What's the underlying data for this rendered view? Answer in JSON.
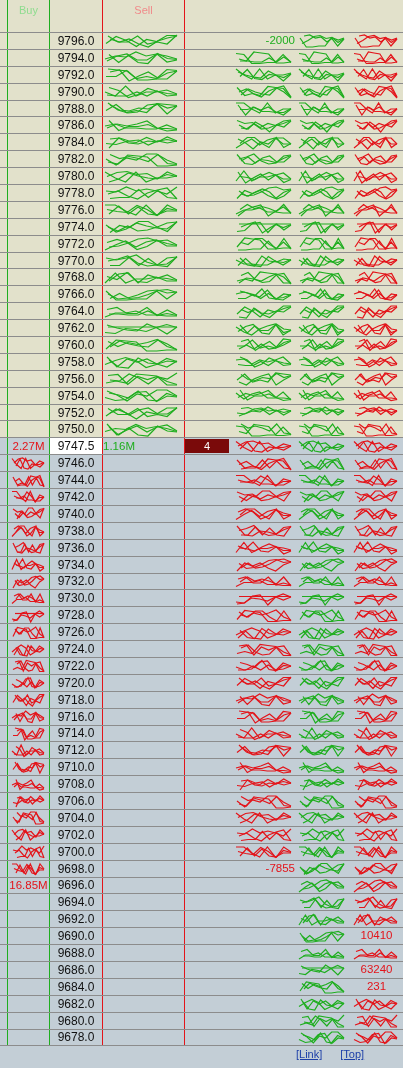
{
  "header": {
    "buy": "Buy",
    "sell": "Sell"
  },
  "rows": [
    {
      "price": "9796.0",
      "ask": true,
      "highlighted": false,
      "column_4": "-2000",
      "overlap_buy": false,
      "overlap_sell": true,
      "overlap_4": false,
      "overlap_5": true,
      "overlap_6": true
    },
    {
      "price": "9794.0",
      "ask": true,
      "highlighted": false,
      "overlap_buy": false,
      "overlap_sell": true,
      "overlap_4": true,
      "overlap_5": true,
      "overlap_6": true
    },
    {
      "price": "9792.0",
      "ask": true,
      "highlighted": false,
      "overlap_buy": false,
      "overlap_sell": true,
      "overlap_4": true,
      "overlap_5": true,
      "overlap_6": true
    },
    {
      "price": "9790.0",
      "ask": true,
      "highlighted": false,
      "overlap_buy": false,
      "overlap_sell": true,
      "overlap_4": true,
      "overlap_5": true,
      "overlap_6": true
    },
    {
      "price": "9788.0",
      "ask": true,
      "highlighted": false,
      "overlap_buy": false,
      "overlap_sell": true,
      "overlap_4": true,
      "overlap_5": true,
      "overlap_6": true
    },
    {
      "price": "9786.0",
      "ask": true,
      "highlighted": false,
      "overlap_buy": false,
      "overlap_sell": true,
      "overlap_4": true,
      "overlap_5": true,
      "overlap_6": true
    },
    {
      "price": "9784.0",
      "ask": true,
      "highlighted": false,
      "overlap_buy": false,
      "overlap_sell": true,
      "overlap_4": true,
      "overlap_5": true,
      "overlap_6": true
    },
    {
      "price": "9782.0",
      "ask": true,
      "highlighted": false,
      "overlap_buy": false,
      "overlap_sell": true,
      "overlap_4": true,
      "overlap_5": true,
      "overlap_6": true
    },
    {
      "price": "9780.0",
      "ask": true,
      "highlighted": false,
      "overlap_buy": false,
      "overlap_sell": true,
      "overlap_4": true,
      "overlap_5": true,
      "overlap_6": true
    },
    {
      "price": "9778.0",
      "ask": true,
      "highlighted": false,
      "overlap_buy": false,
      "overlap_sell": true,
      "overlap_4": true,
      "overlap_5": true,
      "overlap_6": true
    },
    {
      "price": "9776.0",
      "ask": true,
      "highlighted": false,
      "overlap_buy": false,
      "overlap_sell": true,
      "overlap_4": true,
      "overlap_5": true,
      "overlap_6": true
    },
    {
      "price": "9774.0",
      "ask": true,
      "highlighted": false,
      "overlap_buy": false,
      "overlap_sell": true,
      "overlap_4": true,
      "overlap_5": true,
      "overlap_6": true
    },
    {
      "price": "9772.0",
      "ask": true,
      "highlighted": false,
      "overlap_buy": false,
      "overlap_sell": true,
      "overlap_4": true,
      "overlap_5": true,
      "overlap_6": true
    },
    {
      "price": "9770.0",
      "ask": true,
      "highlighted": false,
      "overlap_buy": false,
      "overlap_sell": true,
      "overlap_4": true,
      "overlap_5": true,
      "overlap_6": true
    },
    {
      "price": "9768.0",
      "ask": true,
      "highlighted": false,
      "overlap_buy": false,
      "overlap_sell": true,
      "overlap_4": true,
      "overlap_5": true,
      "overlap_6": true
    },
    {
      "price": "9766.0",
      "ask": true,
      "highlighted": false,
      "overlap_buy": false,
      "overlap_sell": true,
      "overlap_4": true,
      "overlap_5": true,
      "overlap_6": true
    },
    {
      "price": "9764.0",
      "ask": true,
      "highlighted": false,
      "overlap_buy": false,
      "overlap_sell": true,
      "overlap_4": true,
      "overlap_5": true,
      "overlap_6": true
    },
    {
      "price": "9762.0",
      "ask": true,
      "highlighted": false,
      "overlap_buy": false,
      "overlap_sell": true,
      "overlap_4": true,
      "overlap_5": true,
      "overlap_6": true
    },
    {
      "price": "9760.0",
      "ask": true,
      "highlighted": false,
      "overlap_buy": false,
      "overlap_sell": true,
      "overlap_4": true,
      "overlap_5": true,
      "overlap_6": true
    },
    {
      "price": "9758.0",
      "ask": true,
      "highlighted": false,
      "overlap_buy": false,
      "overlap_sell": true,
      "overlap_4": true,
      "overlap_5": true,
      "overlap_6": true
    },
    {
      "price": "9756.0",
      "ask": true,
      "highlighted": false,
      "overlap_buy": false,
      "overlap_sell": true,
      "overlap_4": true,
      "overlap_5": true,
      "overlap_6": true
    },
    {
      "price": "9754.0",
      "ask": true,
      "highlighted": false,
      "overlap_buy": false,
      "overlap_sell": true,
      "overlap_4": true,
      "overlap_5": true,
      "overlap_6": true
    },
    {
      "price": "9752.0",
      "ask": true,
      "highlighted": false,
      "overlap_buy": false,
      "overlap_sell": true,
      "overlap_4": true,
      "overlap_5": true,
      "overlap_6": true
    },
    {
      "price": "9750.0",
      "ask": true,
      "highlighted": false,
      "overlap_buy": false,
      "overlap_sell": true,
      "overlap_4": true,
      "overlap_5": true,
      "overlap_6": true
    },
    {
      "price": "9747.5",
      "ask": false,
      "highlighted": true,
      "buy": "2.27M",
      "sell": "1.16M",
      "order_count": "4",
      "overlap_buy": false,
      "overlap_sell": false,
      "overlap_4": true,
      "overlap_5": true,
      "overlap_6": true
    },
    {
      "price": "9746.0",
      "ask": false,
      "highlighted": false,
      "overlap_buy": true,
      "overlap_sell": false,
      "overlap_4": true,
      "overlap_5": true,
      "overlap_6": true
    },
    {
      "price": "9744.0",
      "ask": false,
      "highlighted": false,
      "overlap_buy": true,
      "overlap_sell": false,
      "overlap_4": true,
      "overlap_5": true,
      "overlap_6": true
    },
    {
      "price": "9742.0",
      "ask": false,
      "highlighted": false,
      "overlap_buy": true,
      "overlap_sell": false,
      "overlap_4": true,
      "overlap_5": true,
      "overlap_6": true
    },
    {
      "price": "9740.0",
      "ask": false,
      "highlighted": false,
      "overlap_buy": true,
      "overlap_sell": false,
      "overlap_4": true,
      "overlap_5": true,
      "overlap_6": true
    },
    {
      "price": "9738.0",
      "ask": false,
      "highlighted": false,
      "overlap_buy": true,
      "overlap_sell": false,
      "overlap_4": true,
      "overlap_5": true,
      "overlap_6": true
    },
    {
      "price": "9736.0",
      "ask": false,
      "highlighted": false,
      "overlap_buy": true,
      "overlap_sell": false,
      "overlap_4": true,
      "overlap_5": true,
      "overlap_6": true
    },
    {
      "price": "9734.0",
      "ask": false,
      "highlighted": false,
      "overlap_buy": true,
      "overlap_sell": false,
      "overlap_4": true,
      "overlap_5": true,
      "overlap_6": true
    },
    {
      "price": "9732.0",
      "ask": false,
      "highlighted": false,
      "overlap_buy": true,
      "overlap_sell": false,
      "overlap_4": true,
      "overlap_5": true,
      "overlap_6": true
    },
    {
      "price": "9730.0",
      "ask": false,
      "highlighted": false,
      "overlap_buy": true,
      "overlap_sell": false,
      "overlap_4": true,
      "overlap_5": true,
      "overlap_6": true
    },
    {
      "price": "9728.0",
      "ask": false,
      "highlighted": false,
      "overlap_buy": true,
      "overlap_sell": false,
      "overlap_4": true,
      "overlap_5": true,
      "overlap_6": true
    },
    {
      "price": "9726.0",
      "ask": false,
      "highlighted": false,
      "overlap_buy": true,
      "overlap_sell": false,
      "overlap_4": true,
      "overlap_5": true,
      "overlap_6": true
    },
    {
      "price": "9724.0",
      "ask": false,
      "highlighted": false,
      "overlap_buy": true,
      "overlap_sell": false,
      "overlap_4": true,
      "overlap_5": true,
      "overlap_6": true
    },
    {
      "price": "9722.0",
      "ask": false,
      "highlighted": false,
      "overlap_buy": true,
      "overlap_sell": false,
      "overlap_4": true,
      "overlap_5": true,
      "overlap_6": true
    },
    {
      "price": "9720.0",
      "ask": false,
      "highlighted": false,
      "overlap_buy": true,
      "overlap_sell": false,
      "overlap_4": true,
      "overlap_5": true,
      "overlap_6": true
    },
    {
      "price": "9718.0",
      "ask": false,
      "highlighted": false,
      "overlap_buy": true,
      "overlap_sell": false,
      "overlap_4": true,
      "overlap_5": true,
      "overlap_6": true
    },
    {
      "price": "9716.0",
      "ask": false,
      "highlighted": false,
      "overlap_buy": true,
      "overlap_sell": false,
      "overlap_4": true,
      "overlap_5": true,
      "overlap_6": true
    },
    {
      "price": "9714.0",
      "ask": false,
      "highlighted": false,
      "overlap_buy": true,
      "overlap_sell": false,
      "overlap_4": true,
      "overlap_5": true,
      "overlap_6": true
    },
    {
      "price": "9712.0",
      "ask": false,
      "highlighted": false,
      "overlap_buy": true,
      "overlap_sell": false,
      "overlap_4": true,
      "overlap_5": true,
      "overlap_6": true
    },
    {
      "price": "9710.0",
      "ask": false,
      "highlighted": false,
      "overlap_buy": true,
      "overlap_sell": false,
      "overlap_4": true,
      "overlap_5": true,
      "overlap_6": true
    },
    {
      "price": "9708.0",
      "ask": false,
      "highlighted": false,
      "overlap_buy": true,
      "overlap_sell": false,
      "overlap_4": true,
      "overlap_5": true,
      "overlap_6": true
    },
    {
      "price": "9706.0",
      "ask": false,
      "highlighted": false,
      "overlap_buy": true,
      "overlap_sell": false,
      "overlap_4": true,
      "overlap_5": true,
      "overlap_6": true
    },
    {
      "price": "9704.0",
      "ask": false,
      "highlighted": false,
      "overlap_buy": true,
      "overlap_sell": false,
      "overlap_4": true,
      "overlap_5": true,
      "overlap_6": true
    },
    {
      "price": "9702.0",
      "ask": false,
      "highlighted": false,
      "overlap_buy": true,
      "overlap_sell": false,
      "overlap_4": true,
      "overlap_5": true,
      "overlap_6": true
    },
    {
      "price": "9700.0",
      "ask": false,
      "highlighted": false,
      "overlap_buy": true,
      "overlap_sell": false,
      "overlap_4": true,
      "overlap_5": true,
      "overlap_6": true
    },
    {
      "price": "9698.0",
      "ask": false,
      "highlighted": false,
      "column_4": "-7855",
      "overlap_buy": true,
      "overlap_sell": false,
      "overlap_4": false,
      "overlap_5": true,
      "overlap_6": true
    },
    {
      "price": "9696.0",
      "ask": false,
      "highlighted": false,
      "buy": "16.85M",
      "overlap_buy": false,
      "overlap_sell": false,
      "overlap_4": false,
      "overlap_5": true,
      "overlap_6": true
    },
    {
      "price": "9694.0",
      "ask": false,
      "highlighted": false,
      "overlap_buy": false,
      "overlap_sell": false,
      "overlap_4": false,
      "overlap_5": true,
      "overlap_6": true
    },
    {
      "price": "9692.0",
      "ask": false,
      "highlighted": false,
      "overlap_buy": false,
      "overlap_sell": false,
      "overlap_4": false,
      "overlap_5": true,
      "overlap_6": true
    },
    {
      "price": "9690.0",
      "ask": false,
      "highlighted": false,
      "column_6": "10410",
      "overlap_buy": false,
      "overlap_sell": false,
      "overlap_4": false,
      "overlap_5": true,
      "overlap_6": false
    },
    {
      "price": "9688.0",
      "ask": false,
      "highlighted": false,
      "overlap_buy": false,
      "overlap_sell": false,
      "overlap_4": false,
      "overlap_5": true,
      "overlap_6": true
    },
    {
      "price": "9686.0",
      "ask": false,
      "highlighted": false,
      "column_6": "63240",
      "overlap_buy": false,
      "overlap_sell": false,
      "overlap_4": false,
      "overlap_5": true,
      "overlap_6": false
    },
    {
      "price": "9684.0",
      "ask": false,
      "highlighted": false,
      "column_6": "231",
      "overlap_buy": false,
      "overlap_sell": false,
      "overlap_4": false,
      "overlap_5": true,
      "overlap_6": false
    },
    {
      "price": "9682.0",
      "ask": false,
      "highlighted": false,
      "overlap_buy": false,
      "overlap_sell": false,
      "overlap_4": false,
      "overlap_5": true,
      "overlap_6": true
    },
    {
      "price": "9680.0",
      "ask": false,
      "highlighted": false,
      "overlap_buy": false,
      "overlap_sell": false,
      "overlap_4": false,
      "overlap_5": true,
      "overlap_6": true
    },
    {
      "price": "9678.0",
      "ask": false,
      "highlighted": false,
      "overlap_buy": false,
      "overlap_sell": false,
      "overlap_4": false,
      "overlap_5": true,
      "overlap_6": true
    }
  ],
  "footer": {
    "links": [
      "[Link]",
      "[Top]"
    ]
  }
}
